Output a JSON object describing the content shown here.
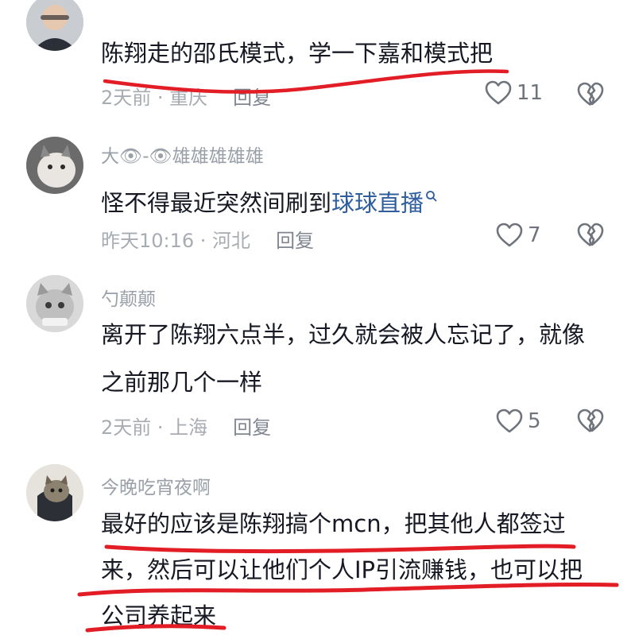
{
  "comments": [
    {
      "username": "",
      "text": "陈翔走的邵氏模式，学一下嘉和模式把",
      "time_location": "2天前 · 重庆",
      "reply_label": "回复",
      "likes": "11"
    },
    {
      "username": "大👁-👁雄雄雄雄雄",
      "text_before_link": "怪不得最近突然间刷到",
      "link": "球球直播",
      "time_location": "昨天10:16 · 河北",
      "reply_label": "回复",
      "likes": "7"
    },
    {
      "username": "勺颠颠",
      "text_lines": [
        "离开了陈翔六点半，过久就会被人忘记了，就像",
        "之前那几个一样"
      ],
      "time_location": "2天前 · 上海",
      "reply_label": "回复",
      "likes": "5"
    },
    {
      "username": "今晚吃宵夜啊",
      "text_lines": [
        "最好的应该是陈翔搞个mcn，把其他人都签过",
        "来，然后可以让他们个人IP引流赚钱，也可以把",
        "公司养起来"
      ]
    }
  ],
  "colors": {
    "underline": "#e21d25",
    "link": "#2f5e9e",
    "meta": "#a7abb2"
  },
  "icons": [
    "heart-outline-icon",
    "broken-heart-icon",
    "search-icon"
  ]
}
